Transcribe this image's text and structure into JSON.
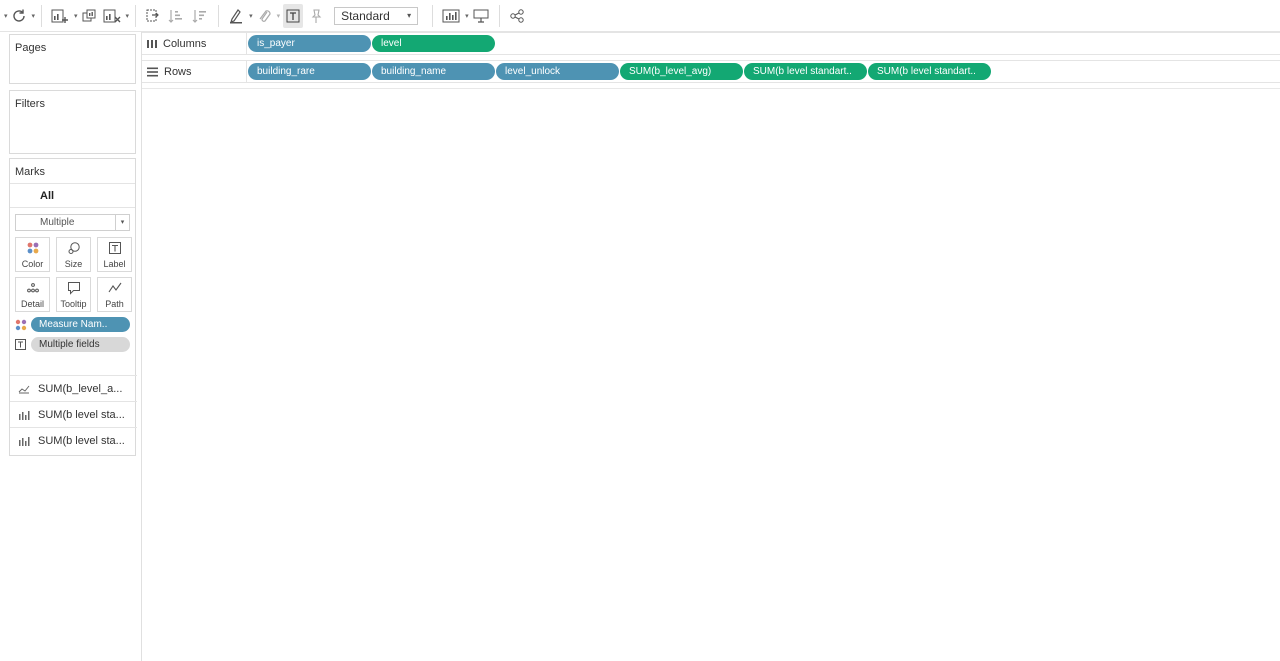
{
  "toolbar": {
    "marks_fit_select": "Standard",
    "icons": [
      "refresh-icon",
      "new-worksheet-icon",
      "duplicate-sheet-icon",
      "clear-sheet-icon",
      "swap-icon",
      "sort-ascending-icon",
      "sort-descending-icon",
      "highlight-icon",
      "group-icon",
      "show-labels-icon",
      "pin-icon",
      "show-me-icon",
      "presentation-icon",
      "share-icon"
    ]
  },
  "left_panel": {
    "pages_title": "Pages",
    "filters_title": "Filters",
    "marks": {
      "title": "Marks",
      "all_label": "All",
      "mark_type": "Multiple",
      "buttons": [
        {
          "label": "Color",
          "icon": "color-icon"
        },
        {
          "label": "Size",
          "icon": "size-icon"
        },
        {
          "label": "Label",
          "icon": "label-icon"
        },
        {
          "label": "Detail",
          "icon": "detail-icon"
        },
        {
          "label": "Tooltip",
          "icon": "tooltip-icon"
        },
        {
          "label": "Path",
          "icon": "path-icon"
        }
      ],
      "fields": [
        {
          "label": "Measure Nam..",
          "icon": "color-icon"
        },
        {
          "label": "Multiple fields",
          "icon": "label-icon"
        }
      ],
      "measure_cards": [
        {
          "label": "SUM(b_level_a...",
          "icon": "line-chart-icon"
        },
        {
          "label": "SUM(b level sta...",
          "icon": "bar-chart-icon"
        },
        {
          "label": "SUM(b level sta...",
          "icon": "bar-chart-icon"
        }
      ]
    }
  },
  "shelves": {
    "columns": {
      "label": "Columns",
      "pills": [
        {
          "label": "is_payer",
          "kind": "dimension"
        },
        {
          "label": "level",
          "kind": "measure"
        }
      ]
    },
    "rows": {
      "label": "Rows",
      "pills": [
        {
          "label": "building_rare",
          "kind": "dimension"
        },
        {
          "label": "building_name",
          "kind": "dimension"
        },
        {
          "label": "level_unlock",
          "kind": "dimension"
        },
        {
          "label": "SUM(b_level_avg)",
          "kind": "measure"
        },
        {
          "label": "SUM(b level standart..",
          "kind": "measure"
        },
        {
          "label": "SUM(b level standart..",
          "kind": "measure"
        }
      ]
    }
  },
  "colors": {
    "dimension_pill": "#4e93b3",
    "measure_pill": "#13a873"
  }
}
